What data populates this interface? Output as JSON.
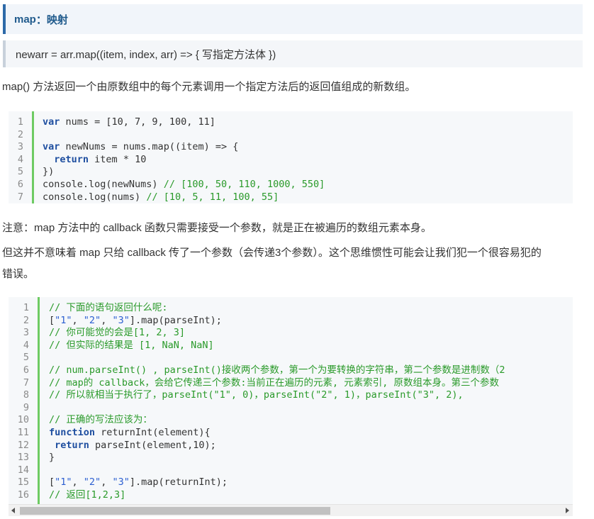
{
  "heading": {
    "label": "map",
    "colon": "：",
    "title": "映射"
  },
  "syntax": "newarr = arr.map((item, index, arr) => { 写指定方法体 })",
  "description": "map() 方法返回一个由原数组中的每个元素调用一个指定方法后的返回值组成的新数组。",
  "code1": [
    {
      "num": "1",
      "parts": [
        {
          "t": "kw",
          "v": "var"
        },
        {
          "t": "",
          "v": " nums = [10, 7, 9, 100, 11]"
        }
      ]
    },
    {
      "num": "2",
      "parts": []
    },
    {
      "num": "3",
      "parts": [
        {
          "t": "kw",
          "v": "var"
        },
        {
          "t": "",
          "v": " newNums = nums.map((item) => {"
        }
      ]
    },
    {
      "num": "4",
      "parts": [
        {
          "t": "",
          "v": "  "
        },
        {
          "t": "kw",
          "v": "return"
        },
        {
          "t": "",
          "v": " item * 10"
        }
      ]
    },
    {
      "num": "5",
      "parts": [
        {
          "t": "",
          "v": "})"
        }
      ]
    },
    {
      "num": "6",
      "parts": [
        {
          "t": "",
          "v": "console.log(newNums) "
        },
        {
          "t": "cm",
          "v": "// [100, 50, 110, 1000, 550]"
        }
      ]
    },
    {
      "num": "7",
      "parts": [
        {
          "t": "",
          "v": "console.log(nums) "
        },
        {
          "t": "cm",
          "v": "// [10, 5, 11, 100, 55]"
        }
      ]
    }
  ],
  "note1": "注意：map 方法中的 callback 函数只需要接受一个参数，就是正在被遍历的数组元素本身。",
  "note2_line1": "但这并不意味着 map 只给 callback 传了一个参数（会传递3个参数）。这个思维惯性可能会让我们犯一个很容易犯的",
  "note2_line2": "错误。",
  "code2": [
    {
      "num": "1",
      "parts": [
        {
          "t": "cm",
          "v": "// 下面的语句返回什么呢:"
        }
      ]
    },
    {
      "num": "2",
      "parts": [
        {
          "t": "",
          "v": "["
        },
        {
          "t": "str",
          "v": "\"1\""
        },
        {
          "t": "",
          "v": ", "
        },
        {
          "t": "str",
          "v": "\"2\""
        },
        {
          "t": "",
          "v": ", "
        },
        {
          "t": "str",
          "v": "\"3\""
        },
        {
          "t": "",
          "v": "].map(parseInt);"
        }
      ]
    },
    {
      "num": "3",
      "parts": [
        {
          "t": "cm",
          "v": "// 你可能觉的会是[1, 2, 3]"
        }
      ]
    },
    {
      "num": "4",
      "parts": [
        {
          "t": "cm",
          "v": "// 但实际的结果是 [1, NaN, NaN]"
        }
      ]
    },
    {
      "num": "5",
      "parts": []
    },
    {
      "num": "6",
      "parts": [
        {
          "t": "cm",
          "v": "// num.parseInt() , parseInt()接收两个参数，第一个为要转换的字符串，第二个参数是进制数（2"
        }
      ]
    },
    {
      "num": "7",
      "parts": [
        {
          "t": "cm",
          "v": "// map的 callback，会给它传递三个参数:当前正在遍历的元素, 元素索引, 原数组本身。第三个参数"
        }
      ]
    },
    {
      "num": "8",
      "parts": [
        {
          "t": "cm",
          "v": "// 所以就相当于执行了，parseInt(\"1\", 0)，parseInt(\"2\", 1)，parseInt(\"3\", 2),"
        }
      ]
    },
    {
      "num": "9",
      "parts": []
    },
    {
      "num": "10",
      "parts": [
        {
          "t": "cm",
          "v": "// 正确的写法应该为："
        }
      ]
    },
    {
      "num": "11",
      "parts": [
        {
          "t": "kw",
          "v": "function"
        },
        {
          "t": "",
          "v": " returnInt(element){"
        }
      ]
    },
    {
      "num": "12",
      "parts": [
        {
          "t": "",
          "v": " "
        },
        {
          "t": "kw",
          "v": "return"
        },
        {
          "t": "",
          "v": " parseInt(element,10);"
        }
      ]
    },
    {
      "num": "13",
      "parts": [
        {
          "t": "",
          "v": "}"
        }
      ]
    },
    {
      "num": "14",
      "parts": []
    },
    {
      "num": "15",
      "parts": [
        {
          "t": "",
          "v": "["
        },
        {
          "t": "str",
          "v": "\"1\""
        },
        {
          "t": "",
          "v": ", "
        },
        {
          "t": "str",
          "v": "\"2\""
        },
        {
          "t": "",
          "v": ", "
        },
        {
          "t": "str",
          "v": "\"3\""
        },
        {
          "t": "",
          "v": "].map(returnInt);"
        }
      ]
    },
    {
      "num": "16",
      "parts": [
        {
          "t": "cm",
          "v": "// 返回[1,2,3]"
        }
      ]
    }
  ],
  "colors": {
    "accent": "#2d6aa8",
    "keyword": "#1f4fa0",
    "comment": "#2a9a2a",
    "string": "#2c5fd1",
    "gutter": "#6ecb63"
  }
}
